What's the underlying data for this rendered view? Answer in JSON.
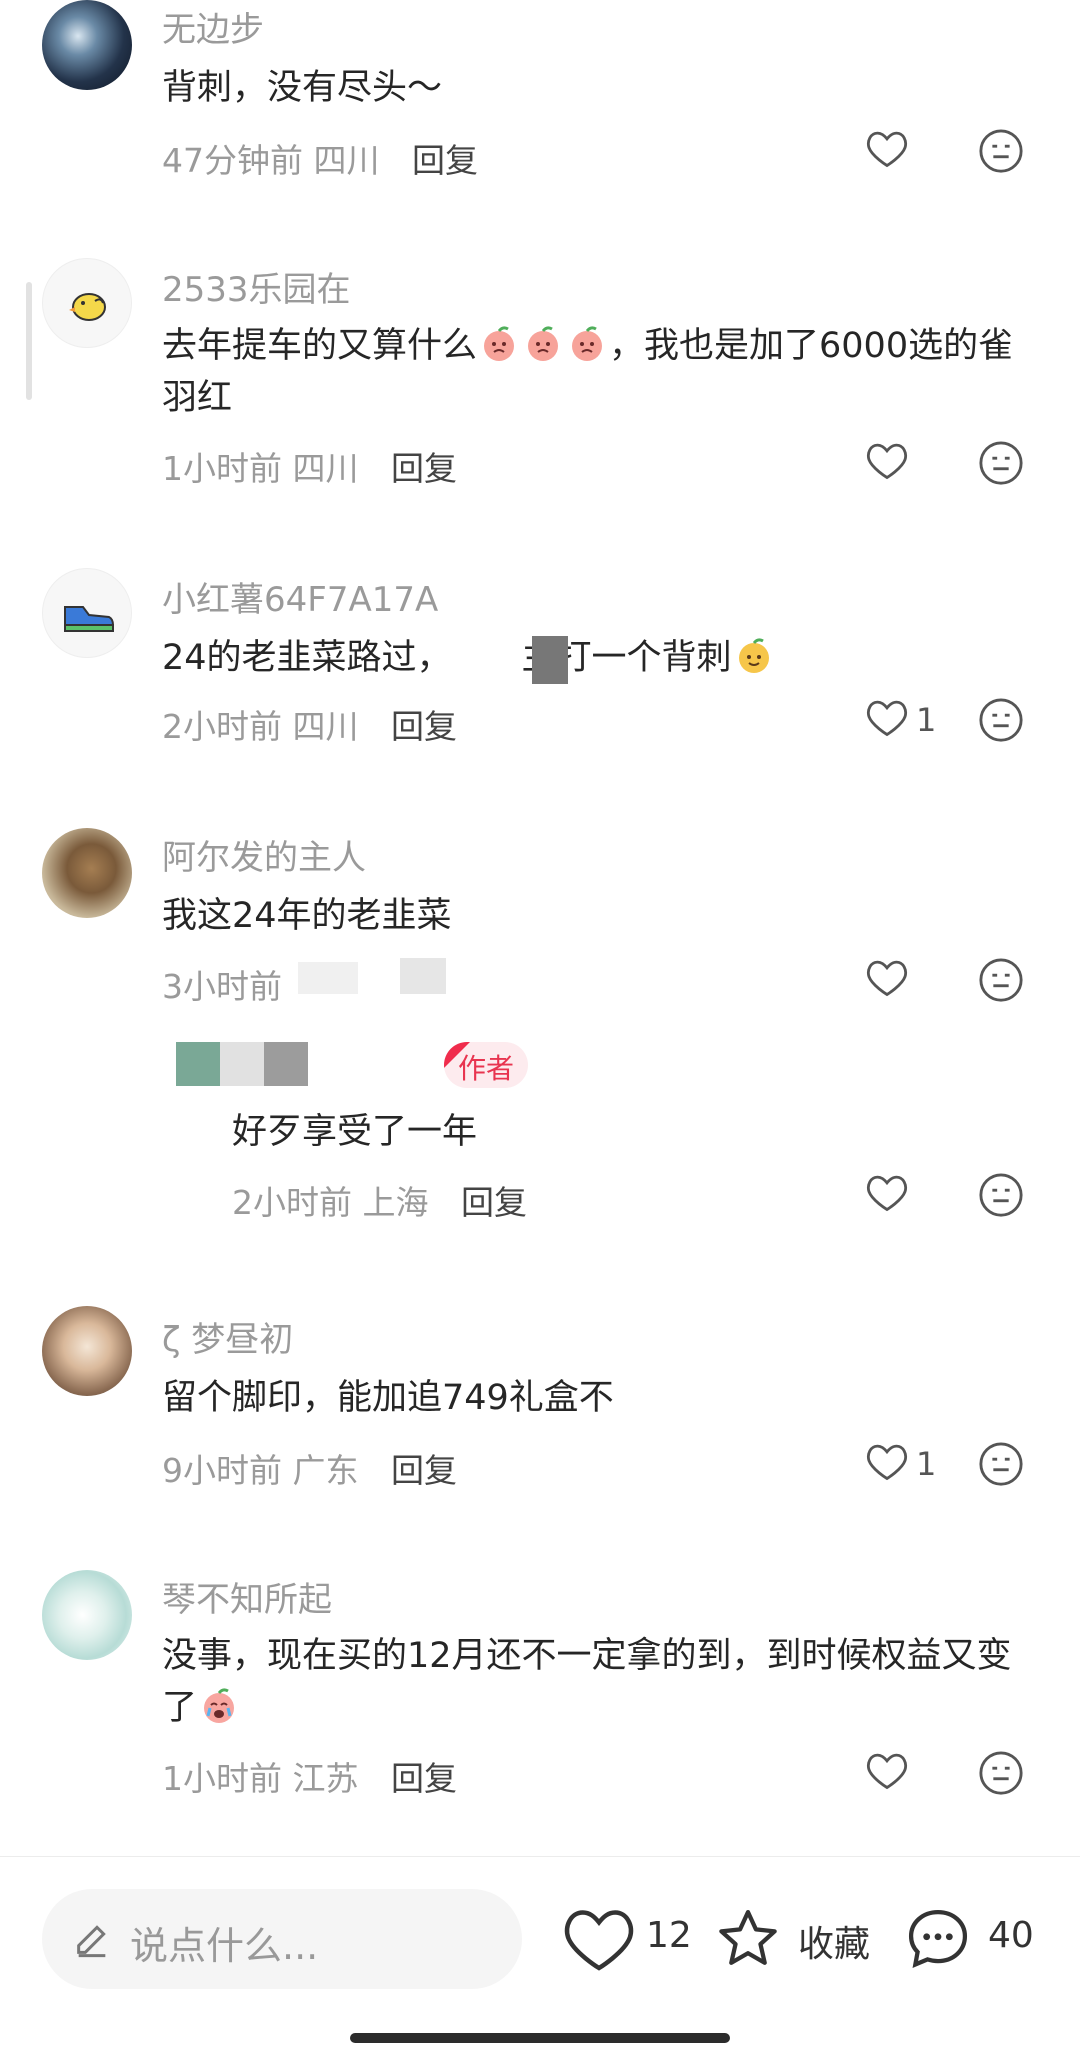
{
  "comments": [
    {
      "username": "无边步",
      "text": "背刺，没有尽头～",
      "time": "47分钟前",
      "location": "四川",
      "reply": "回复",
      "likes": ""
    },
    {
      "username": "2533乐园在",
      "text_a": "去年提车的又算什么",
      "text_b": "，我也是加了6000选的雀羽红",
      "time": "1小时前",
      "location": "四川",
      "reply": "回复",
      "likes": ""
    },
    {
      "username": "小红薯64F7A17A",
      "text_a": "24的老韭菜路过，",
      "text_b": "主打一个背刺",
      "time": "2小时前",
      "location": "四川",
      "reply": "回复",
      "likes": "1"
    },
    {
      "username": "阿尔发的主人",
      "text": "我这24年的老韭菜",
      "time": "3小时前",
      "location": "",
      "reply": "",
      "likes": ""
    },
    {
      "username": "ζ 梦昼初",
      "text": "留个脚印，能加追749礼盒不",
      "time": "9小时前",
      "location": "广东",
      "reply": "回复",
      "likes": "1"
    },
    {
      "username": "琴不知所起",
      "text_a": "没事，现在买的12月还不一定拿的到，到时候权益又变了",
      "time": "1小时前",
      "location": "江苏",
      "reply": "回复",
      "likes": ""
    }
  ],
  "sub_reply": {
    "badge": "作者",
    "text": "好歹享受了一年",
    "time": "2小时前",
    "location": "上海",
    "reply": "回复"
  },
  "bottom_bar": {
    "input_placeholder": "说点什么...",
    "like_count": "12",
    "collect_label": "收藏",
    "comment_count": "40"
  },
  "colors": {
    "meta_gray": "#9a9a9a",
    "author_badge_red": "#e8344f"
  }
}
